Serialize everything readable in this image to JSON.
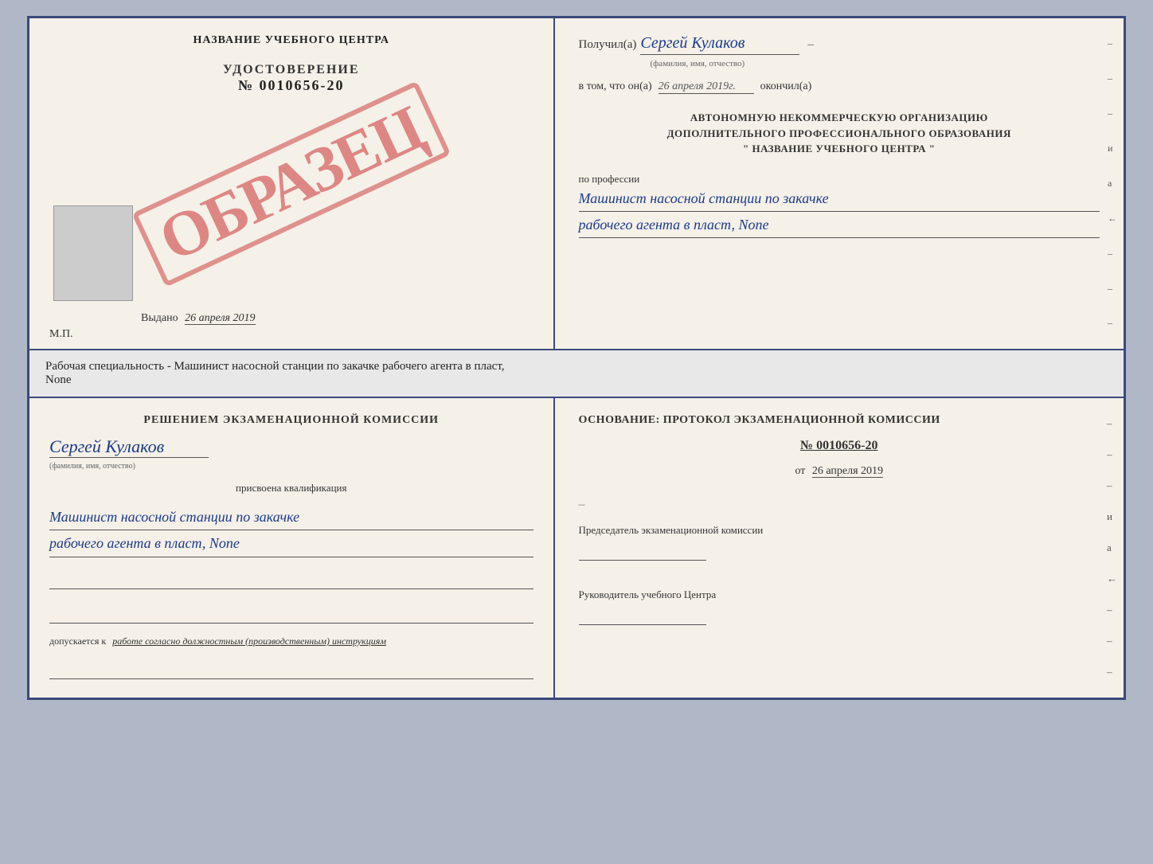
{
  "topDocument": {
    "leftPanel": {
      "schoolTitle": "НАЗВАНИЕ УЧЕБНОГО ЦЕНТРА",
      "certTitle": "УДОСТОВЕРЕНИЕ",
      "certNumber": "№ 0010656-20",
      "stampText": "ОБРАЗЕЦ",
      "issuedLabel": "Выдано",
      "issuedDate": "26 апреля 2019",
      "mpLabel": "М.П."
    },
    "rightPanel": {
      "recipientPrefix": "Получил(а)",
      "recipientName": "Сергей Кулаков",
      "recipientSubLabel": "(фамилия, имя, отчество)",
      "datePrefix": "в том, что он(а)",
      "date": "26 апреля 2019г.",
      "dateSuffix": "окончил(а)",
      "orgLine1": "АВТОНОМНУЮ НЕКОММЕРЧЕСКУЮ ОРГАНИЗАЦИЮ",
      "orgLine2": "ДОПОЛНИТЕЛЬНОГО ПРОФЕССИОНАЛЬНОГО ОБРАЗОВАНИЯ",
      "orgLine3": "\" НАЗВАНИЕ УЧЕБНОГО ЦЕНТРА \"",
      "professionLabel": "по профессии",
      "profession1": "Машинист насосной станции по закачке",
      "profession2": "рабочего агента в пласт, None"
    }
  },
  "middleText": {
    "text": "Рабочая специальность - Машинист насосной станции по закачке рабочего агента в пласт,",
    "textLine2": "None"
  },
  "bottomDocument": {
    "leftPanel": {
      "decisionTitle": "Решением экзаменационной комиссии",
      "personName": "Сергей Кулаков",
      "personSubLabel": "(фамилия, имя, отчество)",
      "qualificationLabel": "присвоена квалификация",
      "profession1": "Машинист насосной станции по закачке",
      "profession2": "рабочего агента в пласт, None",
      "admissionText": "допускается к",
      "admissionItalic": "работе согласно должностным (производственным) инструкциям"
    },
    "rightPanel": {
      "basisTitle": "Основание: протокол экзаменационной комиссии",
      "protocolNumber": "№ 0010656-20",
      "protocolDatePrefix": "от",
      "protocolDate": "26 апреля 2019",
      "chairmanTitle": "Председатель экзаменационной комиссии",
      "directorTitle": "Руководитель учебного Центра"
    }
  },
  "dashes": [
    "-",
    "-",
    "-",
    "и",
    "а",
    "←",
    "-",
    "-",
    "-"
  ],
  "dashesBottom": [
    "-",
    "-",
    "-",
    "и",
    "а",
    "←",
    "-",
    "-",
    "-"
  ]
}
